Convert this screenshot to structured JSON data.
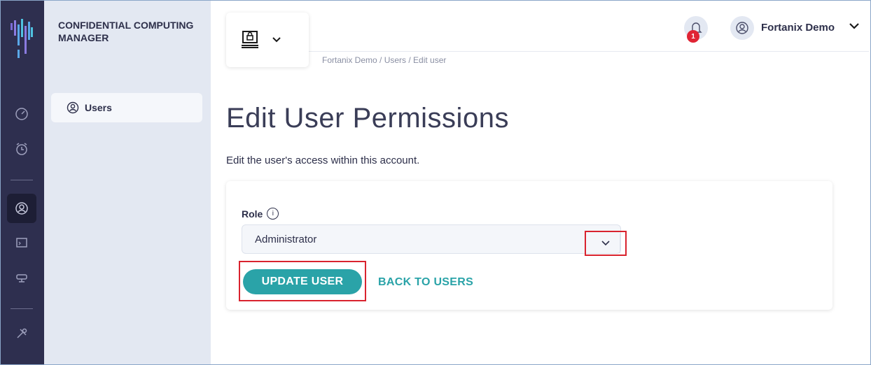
{
  "app": {
    "brand": "CONFIDENTIAL COMPUTING MANAGER",
    "accent_color": "#2aa3a8",
    "highlight_color": "#d9232e"
  },
  "rail": {
    "icons": [
      "logo-icon",
      "dashboard-icon",
      "alarm-clock-icon",
      "users-icon",
      "terminal-icon",
      "node-icon",
      "tools-icon"
    ],
    "active": "users-icon"
  },
  "sidebar": {
    "items": [
      {
        "label": "Users",
        "icon": "user-circle-icon",
        "active": true
      }
    ]
  },
  "header": {
    "app_switcher_icon": "secure-computer-icon",
    "breadcrumb": "Fortanix Demo / Users / Edit user",
    "notifications_count": "1",
    "user_name": "Fortanix Demo"
  },
  "main": {
    "title": "Edit User Permissions",
    "subtitle": "Edit the user's access within this account.",
    "form": {
      "role_label": "Role",
      "info_symbol": "i",
      "role_value": "Administrator",
      "update_button": "UPDATE USER",
      "back_link": "BACK TO USERS"
    }
  }
}
